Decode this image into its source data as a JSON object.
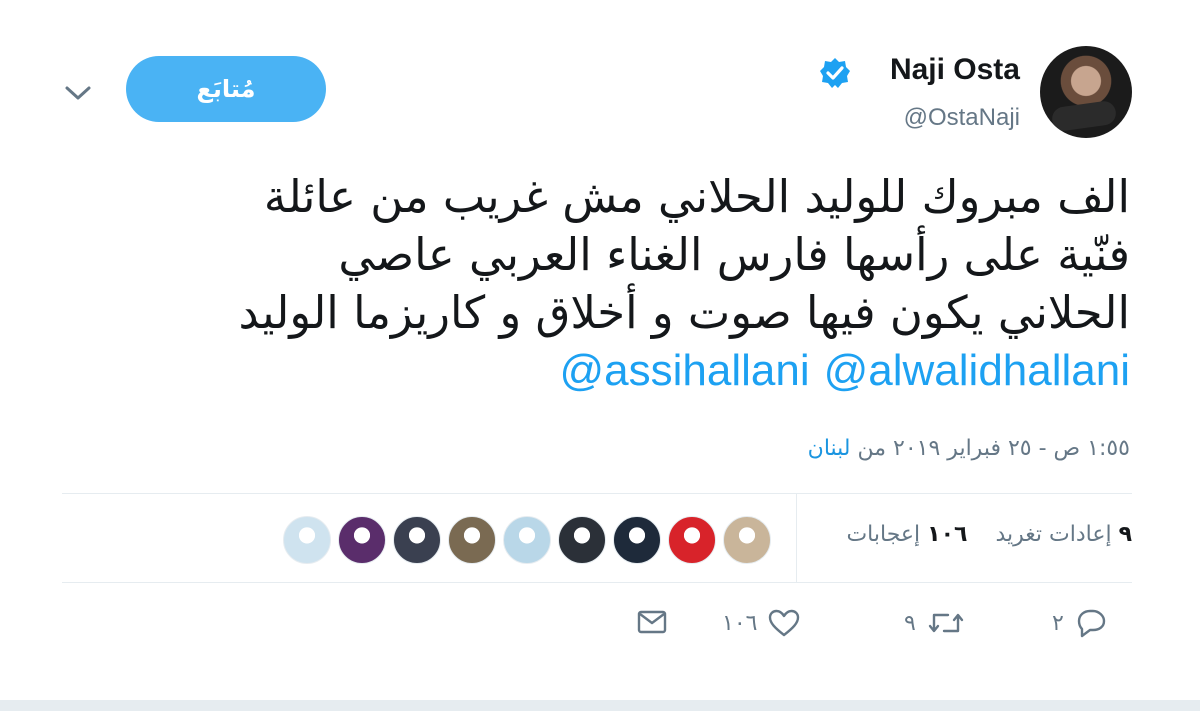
{
  "user": {
    "display_name": "Naji Osta",
    "handle": "@OstaNaji",
    "verified": true
  },
  "follow_button": {
    "label": "مُتابَع"
  },
  "tweet": {
    "lines": [
      "الف مبروك للوليد الحلاني مش غريب من عائلة",
      "فنّية على رأسها فارس الغناء العربي عاصي",
      "الحلاني يكون فيها صوت و أخلاق و كاريزما الوليد"
    ],
    "mentions": [
      "@assihallani",
      "@alwalidhallani"
    ]
  },
  "timestamp": {
    "text": "١:٥٥ ص - ٢٥ فبراير ٢٠١٩ من",
    "place": "لبنان"
  },
  "stats": {
    "retweets_count": "٩",
    "retweets_label": "إعادات تغريد",
    "likes_count": "١٠٦",
    "likes_label": "إعجابات"
  },
  "actions": {
    "reply_count": "٢",
    "retweet_count": "٩",
    "like_count": "١٠٦"
  },
  "icons": {
    "reply": "reply-icon",
    "retweet": "retweet-icon",
    "like": "heart-icon",
    "dm": "envelope-icon",
    "caret": "chevron-down-icon",
    "verified": "verified-badge-icon"
  },
  "likers": [
    {
      "name": "liker-avatar",
      "color": "#c9b59a"
    },
    {
      "name": "liker-avatar",
      "color": "#d8232a"
    },
    {
      "name": "liker-avatar",
      "color": "#1e2a3a"
    },
    {
      "name": "liker-avatar",
      "color": "#2b3038"
    },
    {
      "name": "liker-avatar",
      "color": "#b9d7e8"
    },
    {
      "name": "liker-avatar",
      "color": "#7a6a52"
    },
    {
      "name": "liker-avatar",
      "color": "#3a4050"
    },
    {
      "name": "liker-avatar",
      "color": "#5a2d6b"
    },
    {
      "name": "liker-avatar",
      "color": "#cfe3ef"
    }
  ],
  "colors": {
    "accent": "#1da1f2",
    "follow_bg": "#4ab3f4",
    "muted": "#657786",
    "divider": "#e6ecf0"
  }
}
